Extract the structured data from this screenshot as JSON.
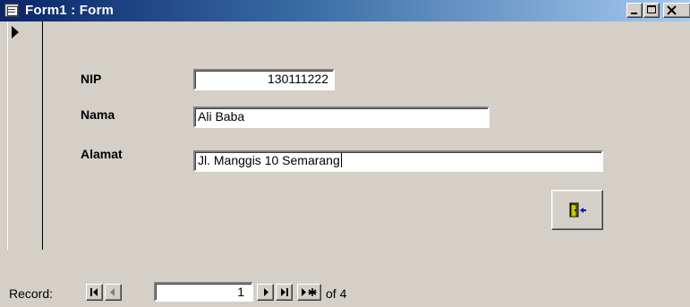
{
  "window": {
    "title": "Form1 : Form",
    "icons": {
      "app": "form-view-icon",
      "minimize": "minimize-icon",
      "maximize": "maximize-icon",
      "close": "close-icon"
    }
  },
  "form": {
    "record_selector_icon": "current-record-arrow-icon",
    "fields": {
      "nip": {
        "label": "NIP",
        "value": "130111222"
      },
      "nama": {
        "label": "Nama",
        "value": "Ali Baba"
      },
      "alamat": {
        "label": "Alamat",
        "value": "Jl. Manggis 10 Semarang"
      }
    },
    "exit_button_icon": "exit-door-icon"
  },
  "navigation": {
    "label": "Record:",
    "current": "1",
    "total_text": "of 4",
    "buttons": {
      "first": "first-record-icon",
      "prev": "previous-record-icon",
      "next": "next-record-icon",
      "last": "last-record-icon",
      "new": "new-record-icon"
    }
  },
  "colors": {
    "title_gradient_start": "#0a246a",
    "title_gradient_end": "#a6caf0",
    "face": "#d4d0c8"
  }
}
